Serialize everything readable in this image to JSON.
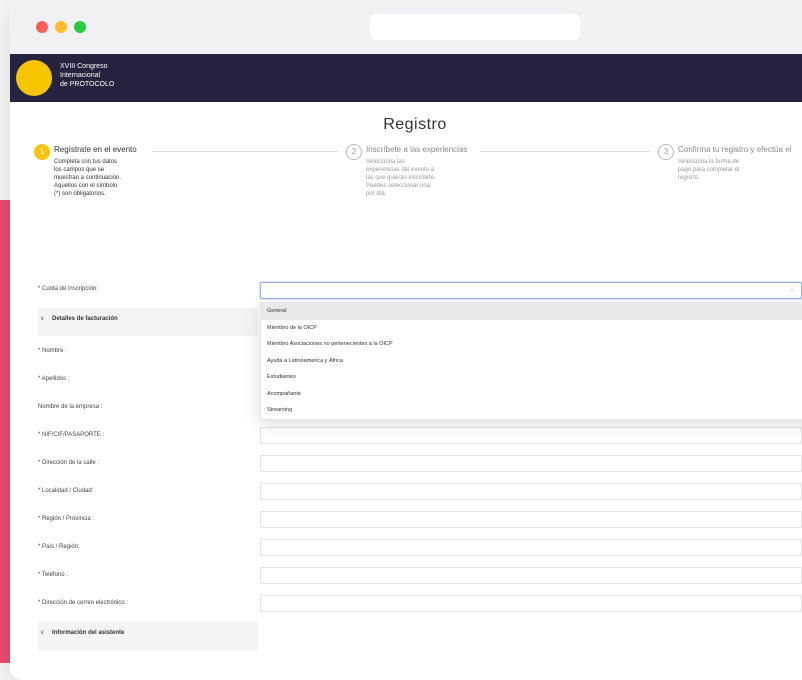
{
  "header": {
    "logo_line1": "XVIII Congreso",
    "logo_line2": "Internacional",
    "logo_line3": "de PROTOCOLO"
  },
  "page": {
    "title": "Registro"
  },
  "steps": [
    {
      "number": "1",
      "title": "Regístrate en el evento",
      "description": "Completa con tus datos los campos que se muestran a continuación. Aquellos con el símbolo (*) son obligatorios."
    },
    {
      "number": "2",
      "title": "Inscríbete a las experiencias",
      "description": "Selecciona las experiencias del evento a las que quieras inscribirte. Puedes seleccionar una por día."
    },
    {
      "number": "3",
      "title": "Confirma tu registro y efectúa el",
      "description": "Selecciona la forma de pago para completar el registro."
    }
  ],
  "form": {
    "cuota_label": "* Cuota de inscripción:",
    "billing_section": "Detalles de facturación",
    "fields": [
      "* Nombre :",
      "* Apellidos :",
      "Nombre de la empresa :",
      "* NIF/CIF/PASAPORTE :",
      "* Dirección de la calle :",
      "* Localidad / Ciudad:",
      "* Región / Provincia :",
      "* País / Región:",
      "* Teléfono :",
      "* Dirección de correo electrónico :"
    ],
    "attendee_section": "Información del asistente"
  },
  "dropdown": {
    "options": [
      "General",
      "Miembro de la OICP",
      "Miembro Asociaciones no pertenecientes a la OICP",
      "Ayuda a Latinoamerica y África",
      "Estudiantes",
      "Acompañante",
      "Streaming"
    ]
  },
  "icons": {
    "chevron": "chevron-down-icon"
  },
  "colors": {
    "accent": "#f6c500",
    "header_bg": "#26233f",
    "pink": "#f04a6f"
  }
}
